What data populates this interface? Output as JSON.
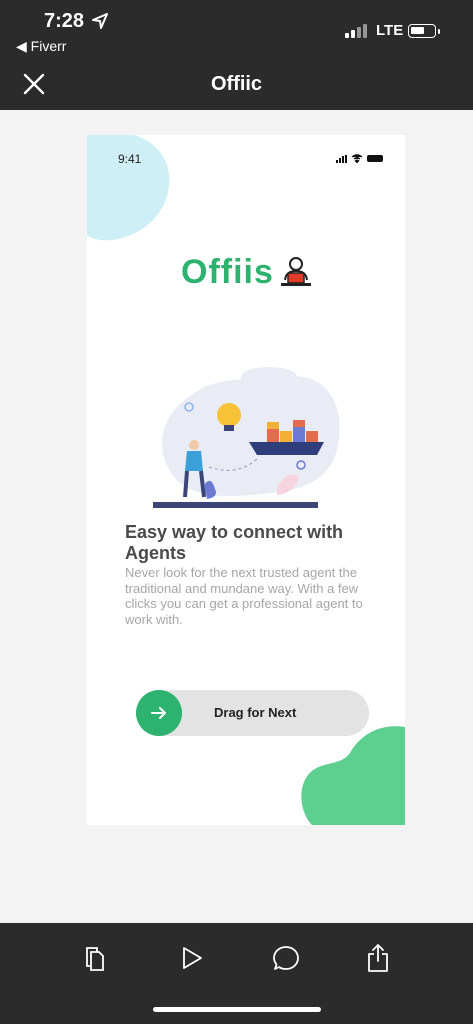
{
  "status_bar": {
    "time": "7:28",
    "back_app": "◀ Fiverr",
    "network": "LTE"
  },
  "nav": {
    "title": "Offiic",
    "close_icon": "close-icon"
  },
  "preview": {
    "time": "9:41",
    "logo_text": "Offiis",
    "headline": "Easy way to connect with Agents",
    "description": "Never look for the next trusted agent the traditional and mundane way. With a few clicks you can get a professional agent to work with.",
    "drag_label": "Drag for Next",
    "colors": {
      "accent": "#2db36f",
      "blob_top": "#cdeff5",
      "blob_bottom": "#5dcf8f"
    }
  },
  "toolbar": {
    "icons": [
      "copy-icon",
      "play-icon",
      "comment-icon",
      "share-icon"
    ]
  }
}
